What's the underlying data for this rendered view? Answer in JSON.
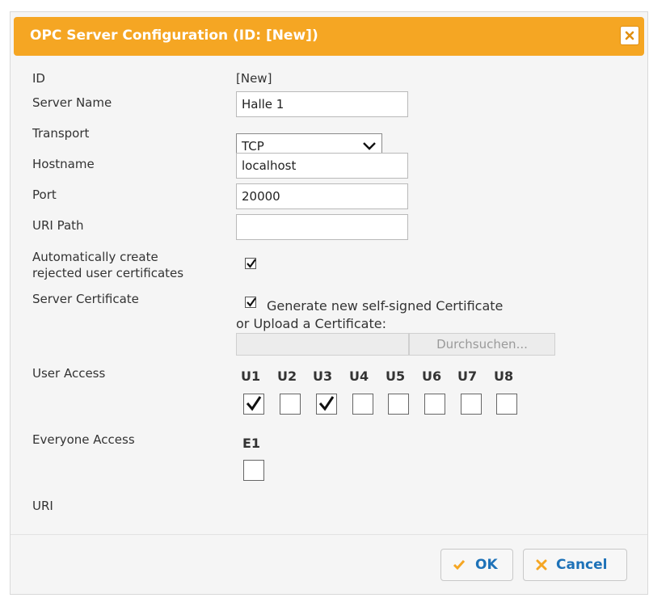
{
  "dialog": {
    "title": "OPC Server Configuration (ID: [New])",
    "accent_color": "#f5a623",
    "close_icon": "close-icon"
  },
  "form": {
    "id_label": "ID",
    "id_value": "[New]",
    "server_name_label": "Server Name",
    "server_name_value": "Halle 1",
    "transport_label": "Transport",
    "transport_value": "TCP",
    "hostname_label": "Hostname",
    "hostname_value": "localhost",
    "port_label": "Port",
    "port_value": "20000",
    "uri_path_label": "URI Path",
    "uri_path_value": "",
    "auto_create_label_line1": "Automatically create",
    "auto_create_label_line2": "rejected user certificates",
    "auto_create_checked": true,
    "server_cert_label": "Server Certificate",
    "generate_cert_label": "Generate new self-signed Certificate",
    "generate_cert_checked": true,
    "upload_label": "or Upload a Certificate:",
    "browse_label": "Durchsuchen...",
    "user_access_label": "User Access",
    "user_access": [
      {
        "label": "U1",
        "checked": true
      },
      {
        "label": "U2",
        "checked": false
      },
      {
        "label": "U3",
        "checked": true
      },
      {
        "label": "U4",
        "checked": false
      },
      {
        "label": "U5",
        "checked": false
      },
      {
        "label": "U6",
        "checked": false
      },
      {
        "label": "U7",
        "checked": false
      },
      {
        "label": "U8",
        "checked": false
      }
    ],
    "everyone_access_label": "Everyone Access",
    "everyone_access": [
      {
        "label": "E1",
        "checked": false
      }
    ],
    "uri_label": "URI"
  },
  "footer": {
    "ok_label": "OK",
    "cancel_label": "Cancel",
    "ok_icon_color": "#f5a623",
    "cancel_icon_color": "#f5a623"
  }
}
